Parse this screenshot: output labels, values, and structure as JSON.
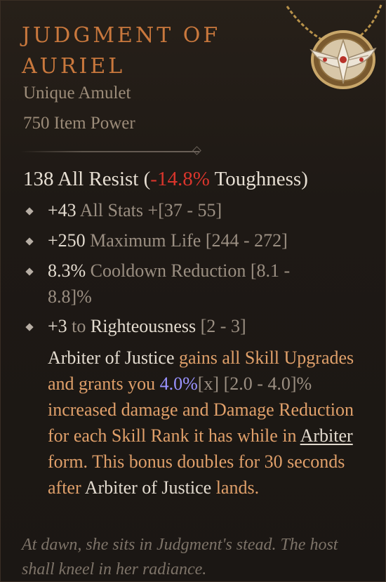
{
  "item": {
    "name_line1": "Judgment of",
    "name_line2": "Auriel",
    "type": "Unique Amulet",
    "item_power": "750 Item Power"
  },
  "implicit": {
    "value": "138 All Resist",
    "paren_open": "(",
    "toughness_delta": "-14.8%",
    "toughness_label": " Toughness)"
  },
  "affixes": [
    {
      "value": "+43",
      "stat": " All Stats",
      "range": " +[37 - 55]"
    },
    {
      "value": "+250",
      "stat": " Maximum Life",
      "range": " [244 - 272]"
    },
    {
      "value": "8.3%",
      "stat": " Cooldown Reduction",
      "range": " [8.1 - 8.8]%"
    },
    {
      "value": "+3",
      "to": " to ",
      "skill": "Righteousness",
      "range": " [2 - 3]"
    }
  ],
  "unique_power": {
    "p1": "Arbiter of Justice",
    "p2": " gains all Skill Upgrades and grants you ",
    "p3": "4.0%",
    "p4": "[x] [2.0 - 4.0]%",
    "p5": " increased damage and Damage Reduction for each Skill Rank it has while in ",
    "p6": "Arbiter",
    "p7": " form. This bonus doubles for 30 seconds after ",
    "p8": "Arbiter of Justice",
    "p9": " lands."
  },
  "flavor_text": "At dawn, she sits in Judgment's stead. The host shall kneel in her radiance.",
  "icons": {
    "amulet": "winged-amulet-icon",
    "bullet": "diamond-bullet-icon",
    "divider": "diamond-divider-icon"
  },
  "colors": {
    "title": "#c9783d",
    "unique_text": "#e0a06a",
    "negative": "#d9352c",
    "highlight": "#9a93ff"
  }
}
